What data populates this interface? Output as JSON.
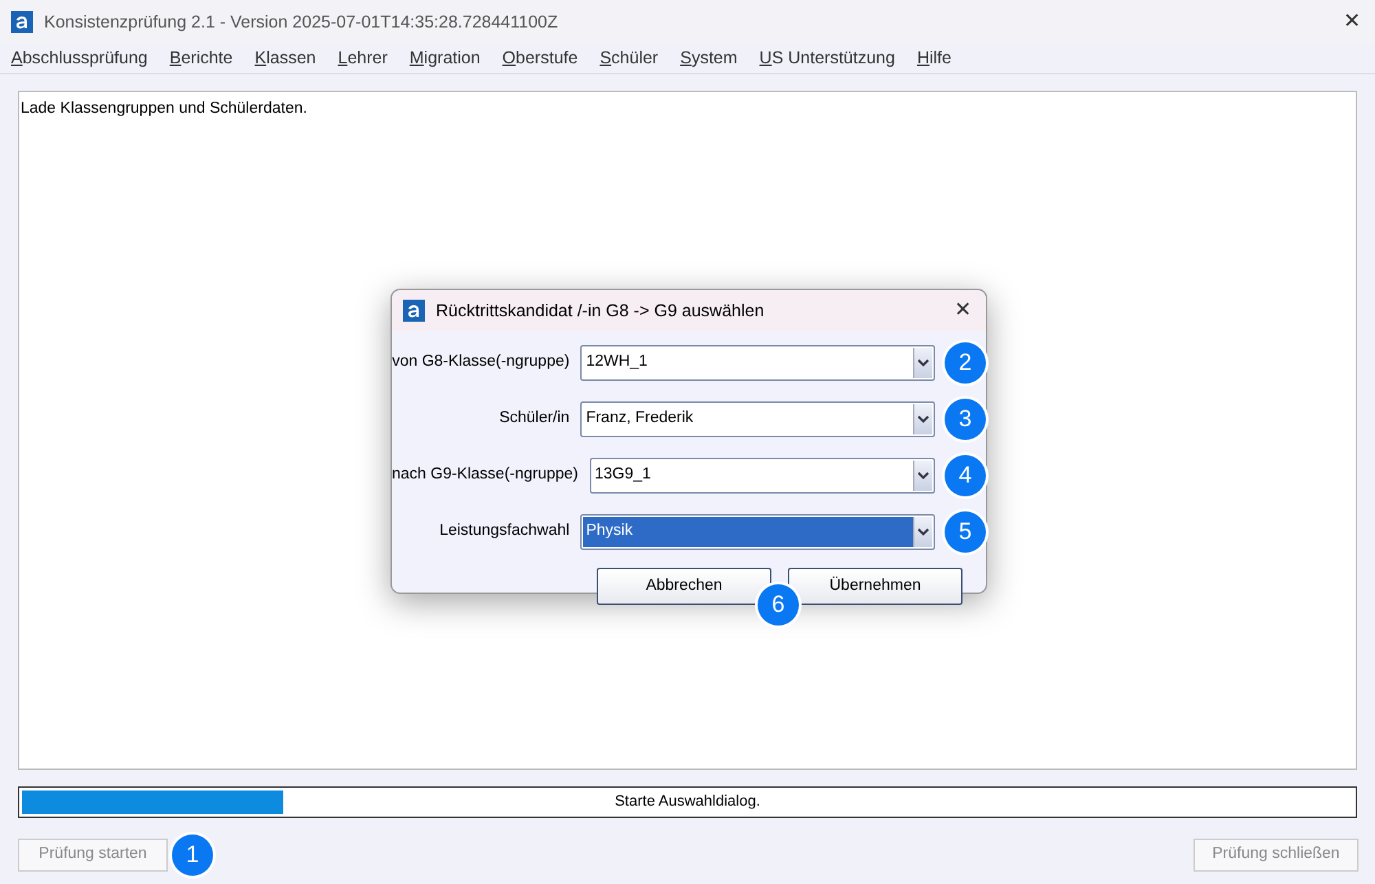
{
  "window": {
    "title": "Konsistenzprüfung 2.1 - Version 2025-07-01T14:35:28.728441100Z",
    "close": "✕"
  },
  "menu": [
    "Abschlussprüfung",
    "Berichte",
    "Klassen",
    "Lehrer",
    "Migration",
    "Oberstufe",
    "Schüler",
    "System",
    "US Unterstützung",
    "Hilfe"
  ],
  "log": [
    "Lade Klassengruppen und Schülerdaten."
  ],
  "dialog": {
    "title": "Rücktrittskandidat /-in G8 -> G9 auswählen",
    "close": "✕",
    "fields": [
      {
        "label": "von G8-Klasse(-ngruppe)",
        "value": "12WH_1",
        "selected": false,
        "marker": "2"
      },
      {
        "label": "Schüler/in",
        "value": "Franz, Frederik",
        "selected": false,
        "marker": "3"
      },
      {
        "label": "nach G9-Klasse(-ngruppe)",
        "value": "13G9_1",
        "selected": false,
        "marker": "4"
      },
      {
        "label": "Leistungsfachwahl",
        "value": "Physik",
        "selected": true,
        "marker": "5"
      }
    ],
    "buttons": [
      "Abbrechen",
      "Übernehmen"
    ],
    "buttons_marker": "6"
  },
  "progress": {
    "level": 0.2,
    "text": "Starte Auswahldialog."
  },
  "start_button": {
    "label": "Prüfung starten",
    "disabled": true,
    "marker": "1"
  },
  "close_button": {
    "label": "Prüfung schließen",
    "disabled": true
  }
}
